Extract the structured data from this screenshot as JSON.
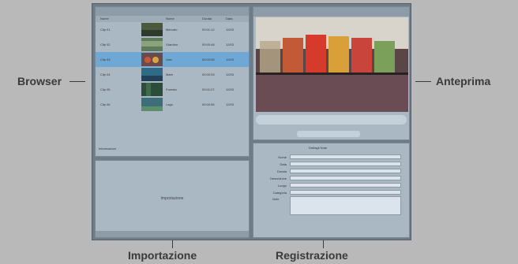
{
  "callouts": {
    "browser": "Browser",
    "preview": "Anteprima",
    "import": "Importazione",
    "record": "Registrazione"
  },
  "browser": {
    "columns": [
      "Nome",
      "Nome",
      "Durata",
      "Data"
    ],
    "rows": [
      {
        "name": "Clip 01",
        "title": "Mercato",
        "duration": "00:01:12",
        "date": "12/03"
      },
      {
        "name": "Clip 02",
        "title": "Giardino",
        "duration": "00:00:48",
        "date": "12/03"
      },
      {
        "name": "Clip 03",
        "title": "Vasi",
        "duration": "00:02:05",
        "date": "12/03"
      },
      {
        "name": "Clip 04",
        "title": "Mare",
        "duration": "00:00:33",
        "date": "12/03"
      },
      {
        "name": "Clip 05",
        "title": "Foresta",
        "duration": "00:01:27",
        "date": "12/03"
      },
      {
        "name": "Clip 06",
        "title": "Lago",
        "duration": "00:00:56",
        "date": "12/03"
      }
    ],
    "footer": "Informazioni"
  },
  "import": {
    "label": "Importazione"
  },
  "record": {
    "tabs": "Dettagli  Note",
    "fields": [
      "Nome",
      "Data",
      "Durata",
      "Descrizione",
      "Luogo",
      "Categoria"
    ],
    "notes_label": "Note"
  }
}
